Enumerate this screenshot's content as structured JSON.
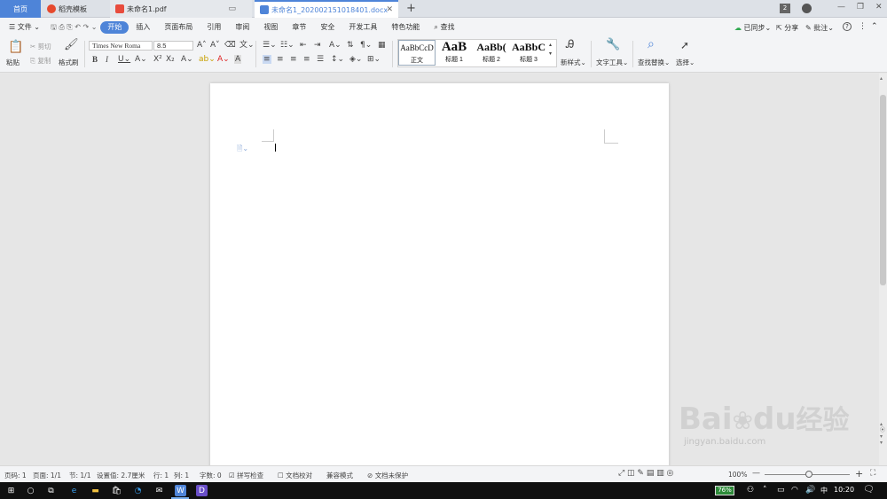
{
  "tabs": {
    "home": "首页",
    "tab1": "稻壳模板",
    "tab2": "未命名1.pdf",
    "tab3": "未命名1_202002151018401.docx",
    "add": "+"
  },
  "window_controls": {
    "badge": "2",
    "min": "—",
    "restore": "❐",
    "close": "✕"
  },
  "menu": {
    "file": "文件",
    "items": [
      "开始",
      "插入",
      "页面布局",
      "引用",
      "审阅",
      "视图",
      "章节",
      "安全",
      "开发工具",
      "特色功能"
    ],
    "search": "查找",
    "sync": "已同步",
    "share": "分享",
    "comment": "批注",
    "help": "?"
  },
  "ribbon": {
    "paste": "粘贴",
    "cut": "剪切",
    "copy": "复制",
    "format_painter": "格式刷",
    "font_name": "Times New Roma",
    "font_size": "8.5",
    "styles": [
      {
        "sample": "AaBbCcD",
        "name": "正文"
      },
      {
        "sample": "AaB",
        "name": "标题 1"
      },
      {
        "sample": "AaBb(",
        "name": "标题 2"
      },
      {
        "sample": "AaBbC",
        "name": "标题 3"
      }
    ],
    "new_style": "新样式",
    "text_tools": "文字工具",
    "find_replace": "查找替换",
    "select": "选择"
  },
  "status": {
    "page_no": "页码: 1",
    "page": "页面: 1/1",
    "section": "节: 1/1",
    "setting": "设置值: 2.7厘米",
    "row": "行: 1",
    "col": "列: 1",
    "words": "字数: 0",
    "spell": "拼写检查",
    "proof": "文档校对",
    "compat": "兼容模式",
    "protect": "文档未保护",
    "zoom": "100%"
  },
  "taskbar": {
    "battery": "76%",
    "ime": "中",
    "time": "10:20"
  },
  "watermark": {
    "brand": "Bai",
    "brand2": "du",
    "cn": "经验",
    "url": "jingyan.baidu.com"
  },
  "colors": {
    "accent": "#4e84d8",
    "taskbar": "#101010"
  }
}
